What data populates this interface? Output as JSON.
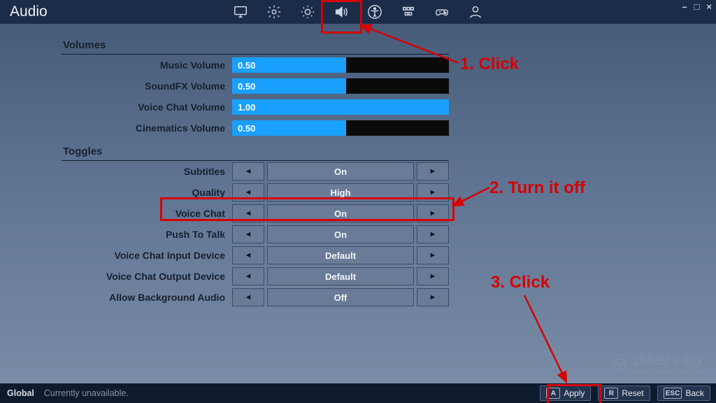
{
  "header": {
    "title": "Audio"
  },
  "window_controls": {
    "min": "–",
    "max": "□",
    "close": "×"
  },
  "sections": {
    "volumes_header": "Volumes",
    "toggles_header": "Toggles"
  },
  "volumes": [
    {
      "label": "Music Volume",
      "value_text": "0.50",
      "fill_pct": 50
    },
    {
      "label": "SoundFX Volume",
      "value_text": "0.50",
      "fill_pct": 50
    },
    {
      "label": "Voice Chat Volume",
      "value_text": "1.00",
      "fill_pct": 100
    },
    {
      "label": "Cinematics Volume",
      "value_text": "0.50",
      "fill_pct": 50
    }
  ],
  "toggles": [
    {
      "label": "Subtitles",
      "value": "On"
    },
    {
      "label": "Quality",
      "value": "High"
    },
    {
      "label": "Voice Chat",
      "value": "On"
    },
    {
      "label": "Push To Talk",
      "value": "On"
    },
    {
      "label": "Voice Chat Input Device",
      "value": "Default"
    },
    {
      "label": "Voice Chat Output Device",
      "value": "Default"
    },
    {
      "label": "Allow Background Audio",
      "value": "Off"
    }
  ],
  "footer": {
    "global_label": "Global",
    "global_status": "Currently unavailable.",
    "apply_key": "A",
    "apply_label": "Apply",
    "reset_key": "R",
    "reset_label": "Reset",
    "back_key": "ESC",
    "back_label": "Back"
  },
  "annotations": {
    "step1": "1. Click",
    "step2": "2. Turn it off",
    "step3": "3. Click"
  },
  "watermark": {
    "brand": "driver easy",
    "url": "www.DriverEasy.com"
  },
  "colors": {
    "accent": "#19a0ff",
    "annotation": "#d80000"
  }
}
